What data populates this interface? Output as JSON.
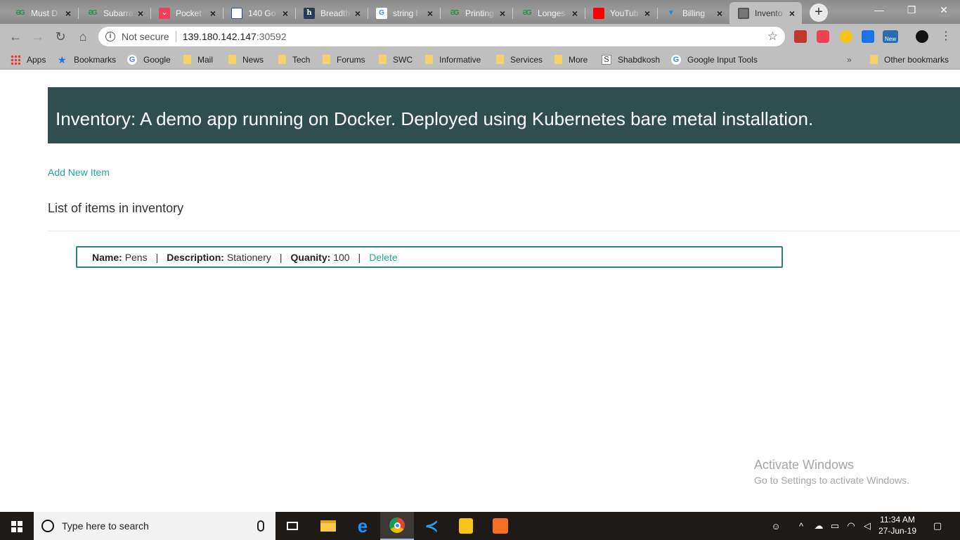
{
  "tabs": [
    {
      "title": "Must D",
      "favicon": "gfg-icon"
    },
    {
      "title": "Subarra",
      "favicon": "gfg-icon"
    },
    {
      "title": "Pocket",
      "favicon": "pocket-icon"
    },
    {
      "title": "140 Go",
      "favicon": "grid-icon"
    },
    {
      "title": "Breadth",
      "favicon": "h-icon"
    },
    {
      "title": "string l",
      "favicon": "google-icon"
    },
    {
      "title": "Printing",
      "favicon": "gfg-icon"
    },
    {
      "title": "Longes",
      "favicon": "gfg-icon"
    },
    {
      "title": "YouTub",
      "favicon": "youtube-icon"
    },
    {
      "title": "Billing",
      "favicon": "billing-icon"
    },
    {
      "title": "Invento",
      "favicon": "globe-icon",
      "active": true
    }
  ],
  "toolbar": {
    "not_secure": "Not secure",
    "url_host": "139.180.142.147",
    "url_port": ":30592",
    "ext_badge": "New"
  },
  "bookmarks": {
    "items": [
      "Apps",
      "Bookmarks",
      "Google",
      "Mail",
      "News",
      "Tech",
      "Forums",
      "SWC",
      "Informative",
      "Services",
      "More",
      "Shabdkosh",
      "Google Input Tools"
    ],
    "overflow": "»",
    "other": "Other bookmarks"
  },
  "page": {
    "banner": "Inventory: A demo app running on Docker. Deployed using Kubernetes bare metal installation.",
    "add_link": "Add New Item",
    "list_heading": "List of items in inventory",
    "item": {
      "name_label": "Name:",
      "name": "Pens",
      "desc_label": "Description:",
      "desc": "Stationery",
      "qty_label": "Quanity:",
      "qty": "100",
      "delete": "Delete",
      "separator": "|"
    }
  },
  "watermark": {
    "line1": "Activate Windows",
    "line2": "Go to Settings to activate Windows."
  },
  "taskbar": {
    "search_placeholder": "Type here to search",
    "time": "11:34 AM",
    "date": "27-Jun-19"
  },
  "colors": {
    "banner_bg": "#2f4f4f",
    "link": "#26a69a",
    "item_border": "#2f7f7b"
  }
}
